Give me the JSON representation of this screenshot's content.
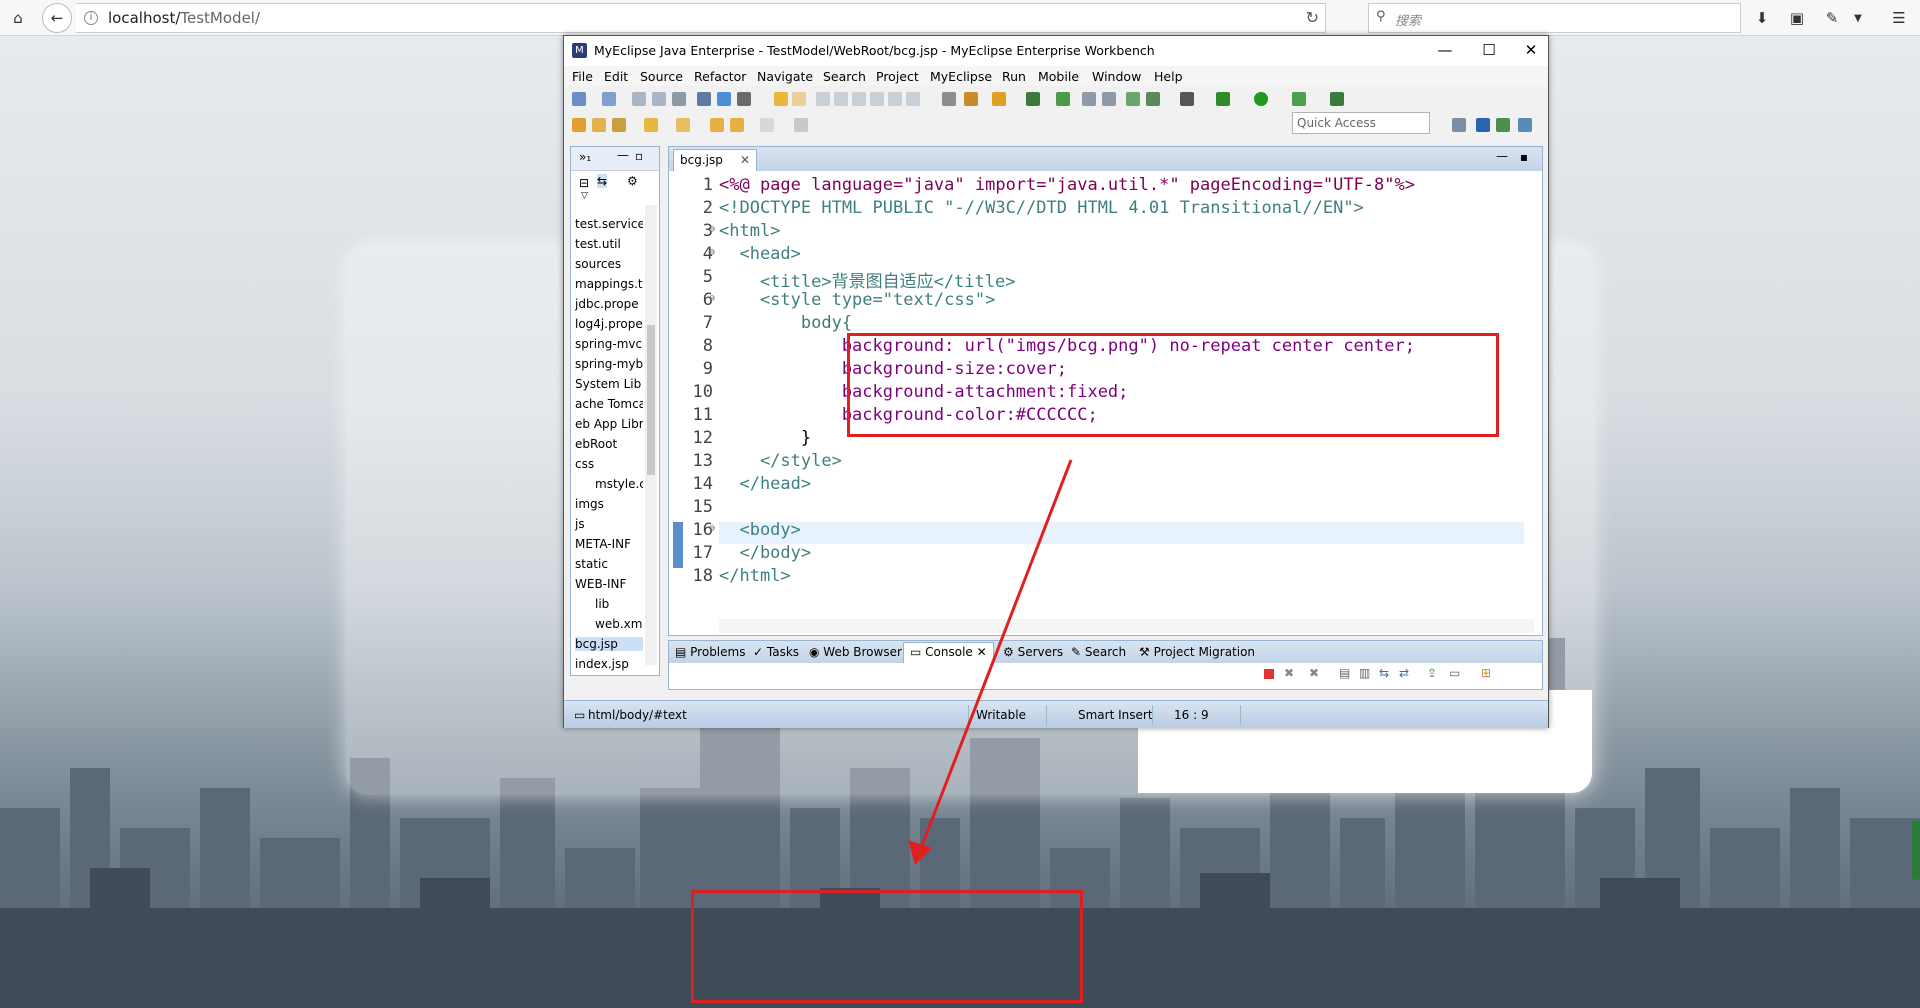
{
  "browser": {
    "url_prefix": "localhost/",
    "url_path": "TestModel/",
    "search_placeholder": "搜索"
  },
  "window": {
    "title": "MyEclipse Java Enterprise - TestModel/WebRoot/bcg.jsp - MyEclipse Enterprise Workbench",
    "menu": [
      "File",
      "Edit",
      "Source",
      "Refactor",
      "Navigate",
      "Search",
      "Project",
      "MyEclipse",
      "Run",
      "Mobile",
      "Window",
      "Help"
    ],
    "quick_access": "Quick Access"
  },
  "explorer": {
    "items": [
      "test.service",
      "test.util",
      "sources",
      "mappings.t",
      "jdbc.prope",
      "log4j.prope",
      "spring-mvc",
      "spring-myb",
      "System Lib",
      "ache Tomca",
      "eb App Libra",
      "ebRoot",
      "css",
      "mstyle.c",
      "imgs",
      "js",
      "META-INF",
      "static",
      "WEB-INF",
      "lib",
      "web.xm",
      "bcg.jsp",
      "index.jsp"
    ]
  },
  "editor": {
    "tab_label": "bcg.jsp",
    "lines": [
      {
        "n": "1",
        "text": "<%@ page language=\"java\" import=\"java.util.*\" pageEncoding=\"UTF-8\"%>"
      },
      {
        "n": "2",
        "text": "<!DOCTYPE HTML PUBLIC \"-//W3C//DTD HTML 4.01 Transitional//EN\">"
      },
      {
        "n": "3",
        "text": "<html>"
      },
      {
        "n": "4",
        "text": "  <head>"
      },
      {
        "n": "5",
        "text": "    <title>背景图自适应</title>"
      },
      {
        "n": "6",
        "text": "    <style type=\"text/css\">"
      },
      {
        "n": "7",
        "text": "        body{"
      },
      {
        "n": "8",
        "text": "            background: url(\"imgs/bcg.png\") no-repeat center center;"
      },
      {
        "n": "9",
        "text": "            background-size:cover;"
      },
      {
        "n": "10",
        "text": "            background-attachment:fixed;"
      },
      {
        "n": "11",
        "text": "            background-color:#CCCCCC;"
      },
      {
        "n": "12",
        "text": "        }"
      },
      {
        "n": "13",
        "text": "    </style>"
      },
      {
        "n": "14",
        "text": "  </head>"
      },
      {
        "n": "15",
        "text": ""
      },
      {
        "n": "16",
        "text": "  <body>"
      },
      {
        "n": "17",
        "text": "  </body>"
      },
      {
        "n": "18",
        "text": "</html>"
      }
    ]
  },
  "console": {
    "tabs": [
      "Problems",
      "Tasks",
      "Web Browser",
      "Console",
      "Servers",
      "Search",
      "Project Migration"
    ]
  },
  "status": {
    "path": "html/body/#text",
    "mode": "Writable",
    "insert": "Smart Insert",
    "position": "16 : 9"
  },
  "colors": {
    "annotation": "#e02020"
  }
}
